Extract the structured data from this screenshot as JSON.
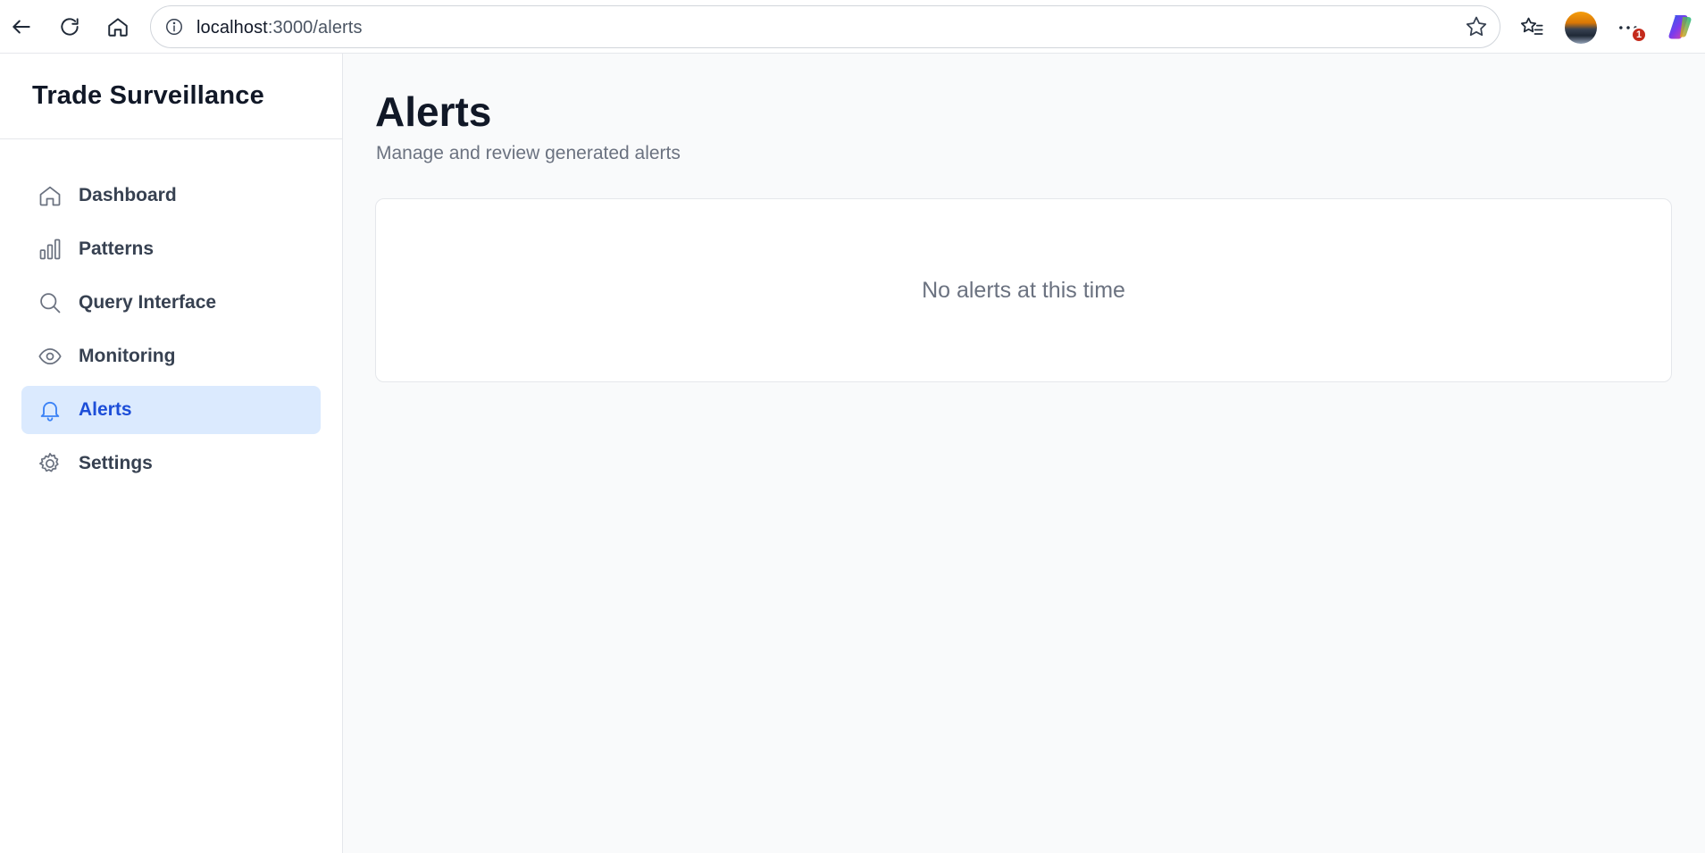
{
  "browser": {
    "url_host": "localhost",
    "url_path": ":3000/alerts",
    "notification_count": "1",
    "icons": {
      "back": "arrow-left-icon",
      "reload": "refresh-icon",
      "home": "home-icon",
      "site_info": "info-icon",
      "favorite": "star-icon",
      "favorites_list": "favorites-list-icon",
      "more": "ellipsis-icon",
      "copilot": "copilot-icon"
    }
  },
  "sidebar": {
    "brand": "Trade Surveillance",
    "items": [
      {
        "label": "Dashboard",
        "icon": "home-icon",
        "active": false
      },
      {
        "label": "Patterns",
        "icon": "bar-chart-icon",
        "active": false
      },
      {
        "label": "Query Interface",
        "icon": "search-icon",
        "active": false
      },
      {
        "label": "Monitoring",
        "icon": "eye-icon",
        "active": false
      },
      {
        "label": "Alerts",
        "icon": "bell-icon",
        "active": true
      },
      {
        "label": "Settings",
        "icon": "gear-icon",
        "active": false
      }
    ]
  },
  "main": {
    "title": "Alerts",
    "subtitle": "Manage and review generated alerts",
    "empty_message": "No alerts at this time"
  },
  "colors": {
    "active_bg": "#dbeafe",
    "active_text": "#1d4ed8",
    "text_primary": "#111827",
    "text_muted": "#6b7280",
    "page_bg": "#f9fafb"
  }
}
